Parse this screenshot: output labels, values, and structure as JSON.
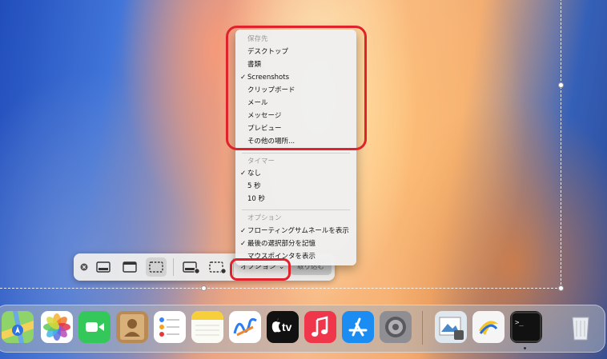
{
  "screenshot_toolbar": {
    "buttons": [
      {
        "name": "close-button",
        "icon": "close-circle-icon"
      },
      {
        "name": "capture-entire-screen-button",
        "icon": "entire-screen-icon"
      },
      {
        "name": "capture-window-button",
        "icon": "window-icon"
      },
      {
        "name": "capture-selection-button",
        "icon": "selection-icon",
        "selected": true
      },
      {
        "name": "record-entire-screen-button",
        "icon": "record-screen-icon"
      },
      {
        "name": "record-selection-button",
        "icon": "record-selection-icon"
      }
    ],
    "options_label": "オプション",
    "options_chevron": "⌄",
    "capture_label": "取り込む"
  },
  "options_menu": {
    "save_to": {
      "header": "保存先",
      "items": [
        {
          "label": "デスクトップ",
          "checked": false
        },
        {
          "label": "書類",
          "checked": false
        },
        {
          "label": "Screenshots",
          "checked": true
        },
        {
          "label": "クリップボード",
          "checked": false
        },
        {
          "label": "メール",
          "checked": false
        },
        {
          "label": "メッセージ",
          "checked": false
        },
        {
          "label": "プレビュー",
          "checked": false
        },
        {
          "label": "その他の場所...",
          "checked": false
        }
      ]
    },
    "timer": {
      "header": "タイマー",
      "items": [
        {
          "label": "なし",
          "checked": true
        },
        {
          "label": "5 秒",
          "checked": false
        },
        {
          "label": "10 秒",
          "checked": false
        }
      ]
    },
    "options": {
      "header": "オプション",
      "items": [
        {
          "label": "フローティングサムネールを表示",
          "checked": true
        },
        {
          "label": "最後の選択部分を記憶",
          "checked": true
        },
        {
          "label": "マウスポインタを表示",
          "checked": false
        }
      ]
    },
    "check_glyph": "✓"
  },
  "annotation_color": "#e0222c",
  "dock": {
    "apps": [
      {
        "name": "maps",
        "icon": "maps-icon"
      },
      {
        "name": "photos",
        "icon": "photos-icon"
      },
      {
        "name": "facetime",
        "icon": "facetime-icon"
      },
      {
        "name": "contacts",
        "icon": "contacts-icon"
      },
      {
        "name": "reminders",
        "icon": "reminders-icon"
      },
      {
        "name": "notes",
        "icon": "notes-icon"
      },
      {
        "name": "freeform",
        "icon": "freeform-icon"
      },
      {
        "name": "apple-tv",
        "icon": "tv-icon",
        "label": "tv"
      },
      {
        "name": "music",
        "icon": "music-icon"
      },
      {
        "name": "app-store",
        "icon": "app-store-icon"
      },
      {
        "name": "system-settings",
        "icon": "settings-icon"
      },
      {
        "name": "preview",
        "icon": "preview-icon"
      },
      {
        "name": "script-app",
        "icon": "script-icon"
      },
      {
        "name": "terminal",
        "icon": "terminal-icon",
        "label": ">_"
      },
      {
        "name": "trash",
        "icon": "trash-icon"
      }
    ]
  }
}
